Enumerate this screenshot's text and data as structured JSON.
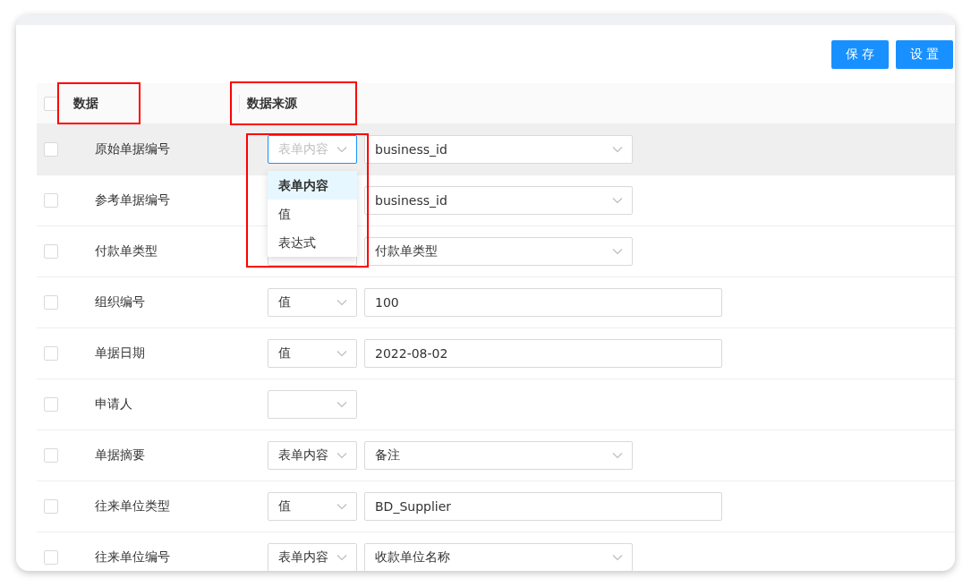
{
  "toolbar": {
    "buttons": [
      {
        "label": "保 存"
      },
      {
        "label": "设 置"
      }
    ]
  },
  "table": {
    "header_checkbox": {
      "checked": false
    },
    "columns": [
      {
        "label": "数据"
      },
      {
        "label": "数据来源"
      }
    ],
    "rows": [
      {
        "checked": false,
        "hovered": true,
        "name": "原始单据编号",
        "source": {
          "value": "表单内容",
          "dropdown": [
            {
              "label": "表单内容",
              "selected": true
            },
            {
              "label": "值",
              "selected": false
            },
            {
              "label": "表达式",
              "selected": false
            }
          ]
        },
        "target": {
          "kind": "select",
          "value": "business_id"
        }
      },
      {
        "checked": false,
        "hovered": false,
        "name": "参考单据编号",
        "source": {},
        "target": {
          "kind": "select",
          "value": "business_id"
        }
      },
      {
        "checked": false,
        "hovered": false,
        "name": "付款单类型",
        "source": {},
        "target": {
          "kind": "select",
          "value": "付款单类型"
        }
      },
      {
        "checked": false,
        "hovered": false,
        "name": "组织编号",
        "source": {
          "value": "值"
        },
        "target": {
          "kind": "input",
          "value": "100"
        }
      },
      {
        "checked": false,
        "hovered": false,
        "name": "单据日期",
        "source": {
          "value": "值"
        },
        "target": {
          "kind": "input",
          "value": "2022-08-02"
        }
      },
      {
        "checked": false,
        "hovered": false,
        "name": "申请人",
        "source": {},
        "target": {
          "kind": "none"
        }
      },
      {
        "checked": false,
        "hovered": false,
        "name": "单据摘要",
        "source": {
          "value": "表单内容"
        },
        "target": {
          "kind": "select",
          "value": "备注"
        }
      },
      {
        "checked": false,
        "hovered": false,
        "name": "往来单位类型",
        "source": {
          "value": "值"
        },
        "target": {
          "kind": "input",
          "value": "BD_Supplier"
        }
      },
      {
        "checked": false,
        "hovered": false,
        "name": "往来单位编号",
        "source": {
          "value": "表单内容"
        },
        "target": {
          "kind": "select",
          "value": "收款单位名称"
        }
      }
    ]
  }
}
